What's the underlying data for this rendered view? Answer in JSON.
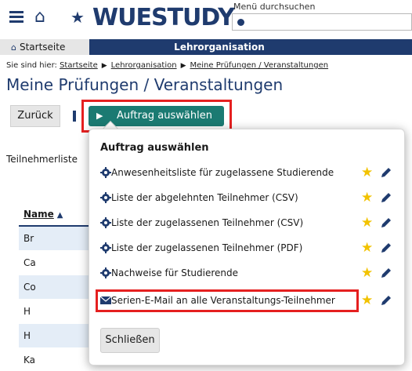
{
  "header": {
    "logo_text": "WUESTUDY",
    "search_label": "Menü durchsuchen",
    "search_value": ""
  },
  "nav": {
    "start_label": "Startseite",
    "lehr_label": "Lehrorganisation"
  },
  "breadcrumb": {
    "prefix": "Sie sind hier:",
    "items": [
      "Startseite",
      "Lehrorganisation",
      "Meine Prüfungen / Veranstaltungen"
    ]
  },
  "page": {
    "title": "Meine Prüfungen / Veranstaltungen",
    "back_label": "Zurück",
    "auftrag_label": "Auftrag auswählen",
    "teilnehmer_label": "Teilnehmerliste"
  },
  "table": {
    "header": "Name",
    "rows": [
      "Br",
      "Ca",
      "Co",
      "H",
      "H",
      "Ka"
    ]
  },
  "popup": {
    "title": "Auftrag auswählen",
    "items": [
      {
        "label": "Anwesenheitsliste für zugelassene Studierende",
        "icon": "gear-icon"
      },
      {
        "label": "Liste der abgelehnten Teilnehmer (CSV)",
        "icon": "gear-icon"
      },
      {
        "label": "Liste der zugelassenen Teilnehmer (CSV)",
        "icon": "gear-icon"
      },
      {
        "label": "Liste der zugelassenen Teilnehmer (PDF)",
        "icon": "gear-icon"
      },
      {
        "label": "Nachweise für Studierende",
        "icon": "gear-icon"
      },
      {
        "label": "Serien-E-Mail an alle Veranstaltungs-Teilnehmer",
        "icon": "mail-icon"
      }
    ],
    "close_label": "Schließen"
  },
  "colors": {
    "primary": "#1f3b6e",
    "teal": "#1b7a72",
    "highlight": "#e52020",
    "star": "#f2c200",
    "row_alt": "#e4edf7"
  }
}
